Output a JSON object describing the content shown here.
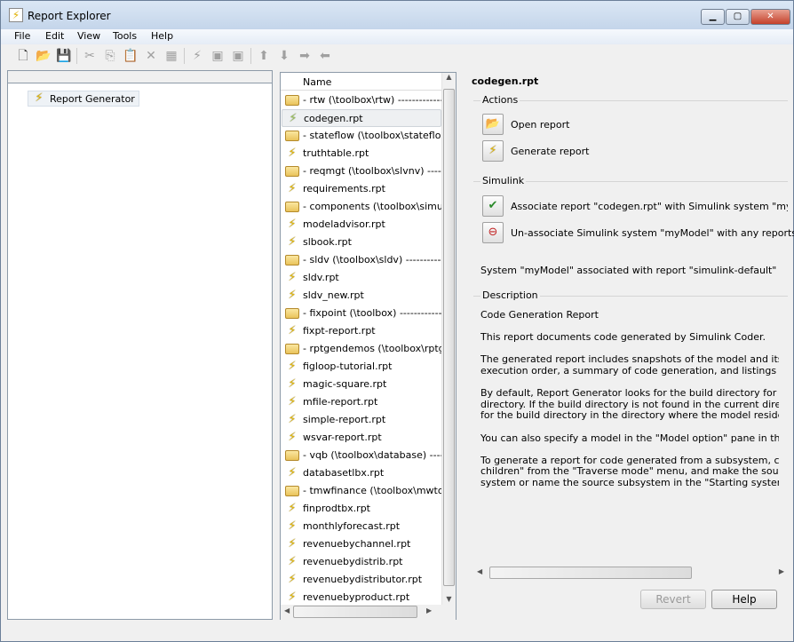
{
  "window": {
    "title": "Report Explorer",
    "controls": {
      "minimize": "▁",
      "maximize": "▢",
      "close": "✕"
    }
  },
  "menu": [
    "File",
    "Edit",
    "View",
    "Tools",
    "Help"
  ],
  "toolbar": [
    "new-icon",
    "open-icon",
    "save-icon",
    "cut-icon",
    "copy-icon",
    "paste-icon",
    "delete-icon",
    "properties-icon",
    "generate-icon",
    "associate-icon",
    "unassociate-icon",
    "move-up-icon",
    "move-down-icon",
    "move-right-icon",
    "move-left-icon"
  ],
  "tree": {
    "root": "Report Generator"
  },
  "list": {
    "header": "Name",
    "selected": 1,
    "rows": [
      {
        "type": "folder",
        "label": "-  rtw (\\toolbox\\rtw)  ----------------"
      },
      {
        "type": "report",
        "label": "codegen.rpt"
      },
      {
        "type": "folder",
        "label": "-  stateflow (\\toolbox\\stateflo.."
      },
      {
        "type": "report",
        "label": "truthtable.rpt"
      },
      {
        "type": "folder",
        "label": "-  reqmgt (\\toolbox\\slvnv)  --------"
      },
      {
        "type": "report",
        "label": "requirements.rpt"
      },
      {
        "type": "folder",
        "label": "-  components (\\toolbox\\simul"
      },
      {
        "type": "report",
        "label": "modeladvisor.rpt"
      },
      {
        "type": "report",
        "label": "slbook.rpt"
      },
      {
        "type": "folder",
        "label": "-  sldv (\\toolbox\\sldv)  ----------------"
      },
      {
        "type": "report",
        "label": "sldv.rpt"
      },
      {
        "type": "report",
        "label": "sldv_new.rpt"
      },
      {
        "type": "folder",
        "label": "-  fixpoint (\\toolbox)  ----------------"
      },
      {
        "type": "report",
        "label": "fixpt-report.rpt"
      },
      {
        "type": "folder",
        "label": "-  rptgendemos (\\toolbox\\rptg"
      },
      {
        "type": "report",
        "label": "figloop-tutorial.rpt"
      },
      {
        "type": "report",
        "label": "magic-square.rpt"
      },
      {
        "type": "report",
        "label": "mfile-report.rpt"
      },
      {
        "type": "report",
        "label": "simple-report.rpt"
      },
      {
        "type": "report",
        "label": "wsvar-report.rpt"
      },
      {
        "type": "folder",
        "label": "-  vqb (\\toolbox\\database)  --------"
      },
      {
        "type": "report",
        "label": "databasetlbx.rpt"
      },
      {
        "type": "folder",
        "label": "-  tmwfinance (\\toolbox\\mwto."
      },
      {
        "type": "report",
        "label": "finprodtbx.rpt"
      },
      {
        "type": "report",
        "label": "monthlyforecast.rpt"
      },
      {
        "type": "report",
        "label": "revenuebychannel.rpt"
      },
      {
        "type": "report",
        "label": "revenuebydistrib.rpt"
      },
      {
        "type": "report",
        "label": "revenuebydistributor.rpt"
      },
      {
        "type": "report",
        "label": "revenuebyproduct.rpt"
      }
    ]
  },
  "details": {
    "title": "codegen.rpt",
    "actions": {
      "label": "Actions",
      "open": "Open report",
      "generate": "Generate report"
    },
    "simulink": {
      "label": "Simulink",
      "associate": "Associate report \"codegen.rpt\" with Simulink system \"myModel\"",
      "unassociate": "Un-associate Simulink system \"myModel\" with any reports",
      "status": "System \"myModel\" associated with report \"simulink-default\""
    },
    "description": {
      "label": "Description",
      "paragraphs": [
        [
          "Code Generation Report"
        ],
        [
          "This report documents code generated by Simulink Coder."
        ],
        [
          "The generated report includes snapshots of the model and its subsystems,",
          "execution order, a summary of code generation, and listings of the generated"
        ],
        [
          "By default, Report Generator looks for the build directory for the current",
          "directory. If the build directory is not found in the current directory, Report",
          "for the build directory in the directory where the model resides."
        ],
        [
          "You can also specify a model in the \"Model option\" pane in the \"Model Loop\""
        ],
        [
          "To generate a report for code generated from a subsystem, choose \"S",
          "children\" from the \"Traverse mode\" menu, and make the source subsystem",
          "system or name the source subsystem  in the \"Starting system(s)\" option"
        ]
      ]
    }
  },
  "buttons": {
    "revert": "Revert",
    "help": "Help"
  }
}
